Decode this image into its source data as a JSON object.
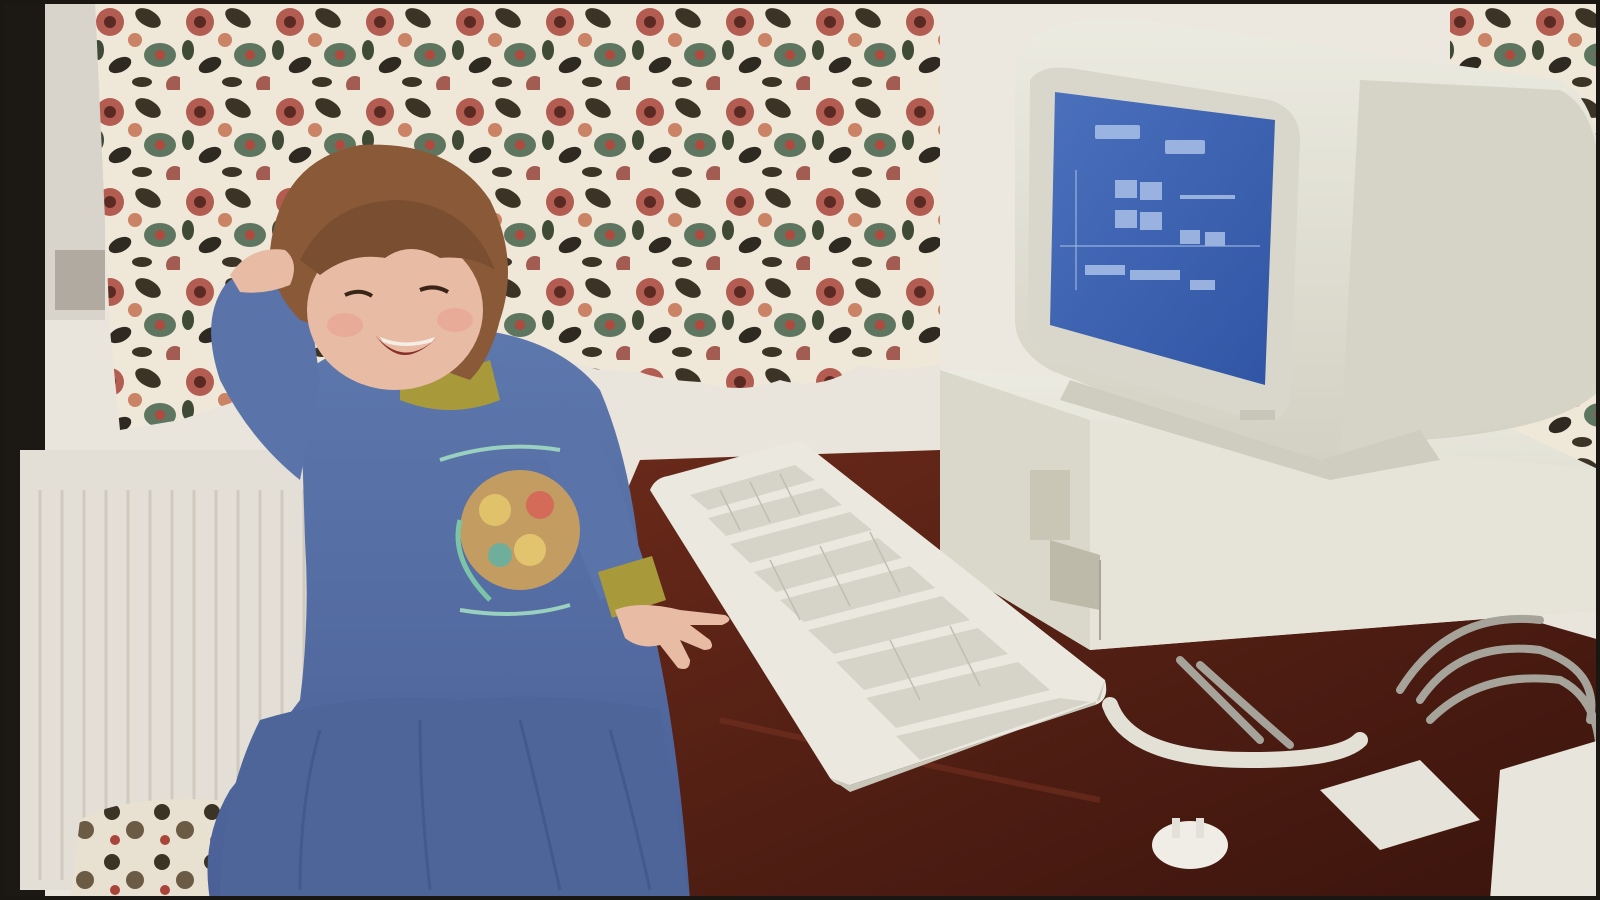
{
  "photo": {
    "palette": {
      "wall": "#e9e4dc",
      "curtain_base": "#efe7d8",
      "curtain_red": "#a8443a",
      "curtain_dark": "#3a3326",
      "curtain_green": "#4f6a52",
      "radiator": "#e6e1d8",
      "desk": "#5a2216",
      "desk_highlight": "#7a3422",
      "dress": "#5a73a8",
      "dress_shadow": "#44598a",
      "hair": "#8a5a38",
      "skin": "#e6b8a0",
      "turtleneck": "#a89a3a",
      "computer_beige": "#e4e2d6",
      "computer_shadow": "#b9b7a8",
      "screen_blue": "#3f64b0",
      "screen_lines": "#a9c0e8",
      "cable_grey": "#9a9890"
    }
  },
  "monitor": {
    "brand_label": ""
  }
}
